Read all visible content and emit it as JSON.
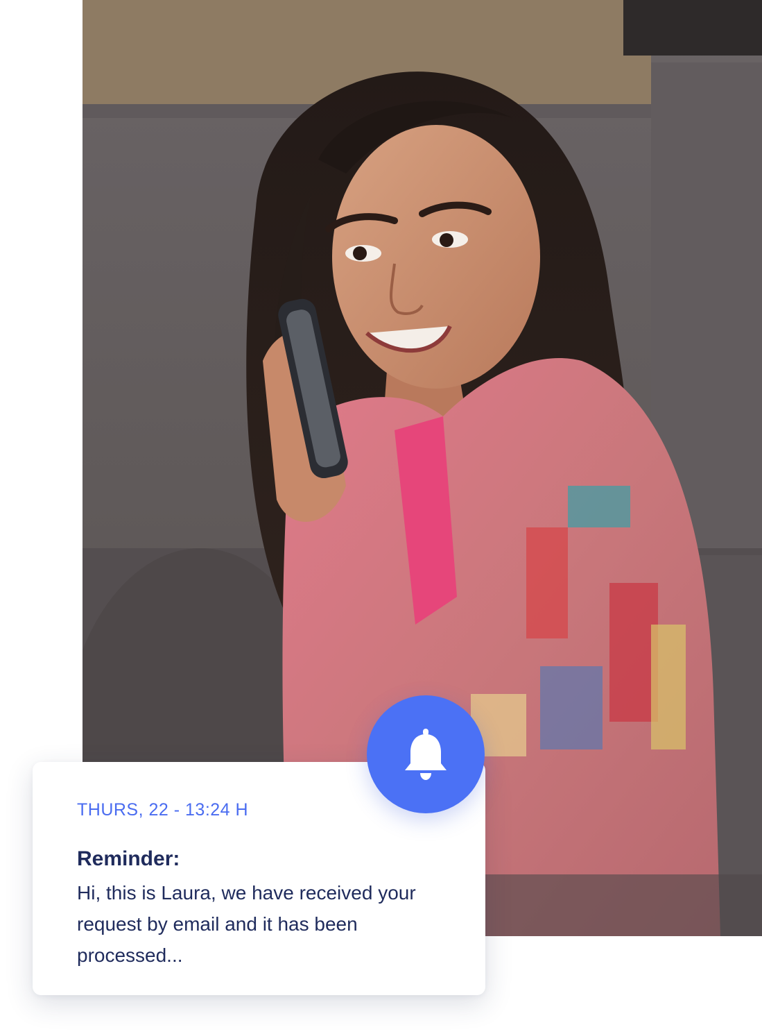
{
  "photo": {
    "icon": "person-on-phone-photo"
  },
  "notification": {
    "date": "THURS, 22 - 13:24 H",
    "title": "Reminder:",
    "message": "Hi, this is Laura, we have received your request by email and it has been processed...",
    "icon": "bell-icon",
    "accent_color": "#4b71f5",
    "text_color": "#1f2b5c"
  }
}
